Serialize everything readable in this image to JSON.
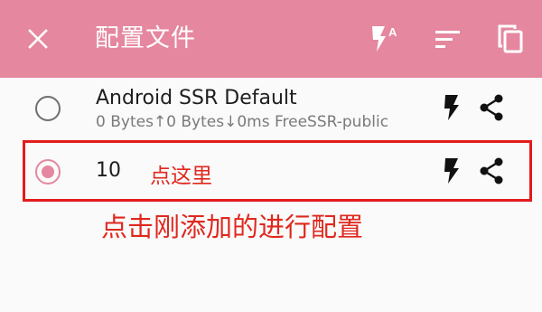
{
  "toolbar": {
    "title": "配置文件",
    "icons": [
      "close-icon",
      "flash-auto-icon",
      "sort-icon",
      "copy-icon"
    ],
    "background_color": "#e5879f",
    "flash_auto_badge": "A"
  },
  "profiles": [
    {
      "name": "Android SSR Default",
      "stats": "0 Bytes↑0 Bytes↓0ms FreeSSR-public",
      "selected": false
    },
    {
      "name": "10",
      "selected": true
    }
  ],
  "row_icons": [
    "flash-icon",
    "share-icon"
  ],
  "annotations": {
    "click_here": "点这里",
    "instruction": "点击刚添加的进行配置",
    "color": "#e0281e"
  }
}
